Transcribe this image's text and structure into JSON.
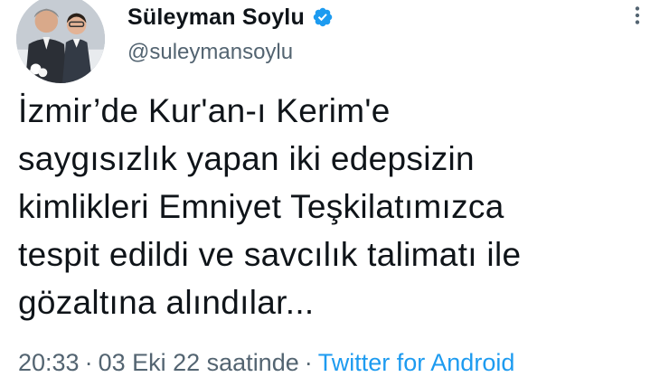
{
  "tweet": {
    "author": {
      "display_name": "Süleyman Soylu",
      "handle": "@suleymansoylu",
      "verified": true,
      "verified_icon": "verified-badge-icon",
      "verified_color": "#1d9bf0"
    },
    "more_icon": "more-options-icon",
    "text": "İzmir’de Kur'an-ı Kerim'e\nsaygısızlık yapan iki edepsizin\nkimlikleri Emniyet Teşkilatımızca\ntespit edildi ve savcılık talimatı ile\ngözaltına alındılar...",
    "time": "20:33",
    "separator": "·",
    "date": "03 Eki 22 saatinde",
    "source": "Twitter for Android",
    "accent_color": "#1d9bf0",
    "secondary_text_color": "#536471"
  }
}
